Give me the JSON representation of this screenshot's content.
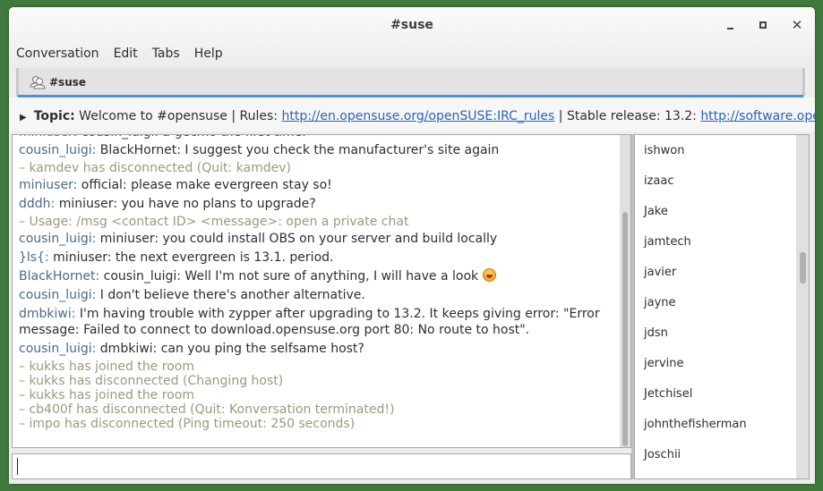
{
  "window": {
    "title": "#suse",
    "controls": {
      "minimize": "minimize",
      "maximize": "maximize",
      "close": "✕"
    }
  },
  "menubar": [
    "Conversation",
    "Edit",
    "Tabs",
    "Help"
  ],
  "tabs": [
    {
      "label": "#suse",
      "icon": "group-chat-icon"
    }
  ],
  "topic": {
    "label": "Topic:",
    "text1": " Welcome to #opensuse | Rules: ",
    "link1": "http://en.opensuse.org/openSUSE:IRC_rules",
    "text2": " | Stable release: 13.2: ",
    "link2": "http://software.opensu..."
  },
  "messages": [
    {
      "type": "msg",
      "nick": "cousin_luigi",
      "text": "BlackHornet: I suggest you check the manufacturer's site again"
    },
    {
      "type": "sys",
      "text": "– kamdev has disconnected (Quit: kamdev)"
    },
    {
      "type": "msg",
      "nick": "miniuser",
      "text": "official: please make evergreen stay so!"
    },
    {
      "type": "msg",
      "nick": "dddh",
      "text": "miniuser: you have no plans to upgrade?"
    },
    {
      "type": "sys",
      "text": "– Usage: /msg <contact ID> <message>: open a private chat"
    },
    {
      "type": "msg",
      "nick": "cousin_luigi",
      "text": "miniuser: you could install OBS on your server and build locally"
    },
    {
      "type": "msg",
      "nick": "}ls{",
      "text": "miniuser: the next evergreen is 13.1. period."
    },
    {
      "type": "msg",
      "nick": "BlackHornet",
      "text": "cousin_luigi: Well I'm not sure of anything, I will have a look",
      "emoji": "laughing-emoji"
    },
    {
      "type": "msg",
      "nick": "cousin_luigi",
      "text": "I don't believe there's another alternative."
    },
    {
      "type": "msg",
      "nick": "dmbkiwi",
      "text": "I'm having trouble with zypper after upgrading to 13.2.  It keeps giving error: \"Error message: Failed to connect to download.opensuse.org port 80: No route to host\"."
    },
    {
      "type": "msg",
      "nick": "cousin_luigi",
      "text": "dmbkiwi: can you ping the selfsame host?"
    },
    {
      "type": "sys",
      "text": "– kukks has joined the room"
    },
    {
      "type": "sys",
      "text": "– kukks has disconnected (Changing host)"
    },
    {
      "type": "sys",
      "text": "– kukks has joined the room"
    },
    {
      "type": "sys",
      "text": "– cb400f has disconnected (Quit: Konversation terminated!)"
    },
    {
      "type": "sys",
      "text": "– impo has disconnected (Ping timeout: 250 seconds)"
    }
  ],
  "input": {
    "value": ""
  },
  "nicklist": [
    "ishwon",
    "izaac",
    "Jake",
    "jamtech",
    "javier",
    "jayne",
    "jdsn",
    "jervine",
    "Jetchisel",
    "johnthefisherman",
    "Joschii"
  ]
}
